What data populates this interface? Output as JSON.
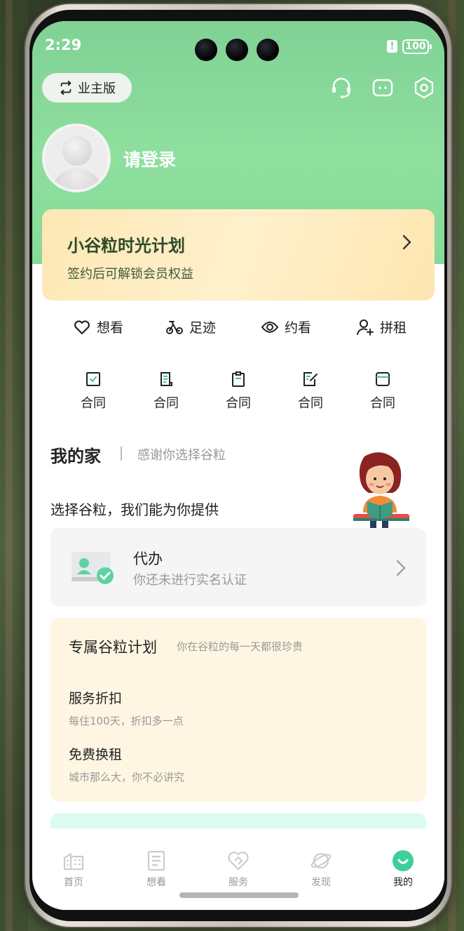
{
  "status_bar": {
    "time": "2:29",
    "battery_level": "100",
    "battery_alert": "!"
  },
  "header": {
    "owner_button_label": "业主版",
    "login_prompt": "请登录",
    "icons": [
      "headset-icon",
      "chat-icon",
      "settings-icon"
    ]
  },
  "plan_card": {
    "title": "小谷粒时光计划",
    "subtitle": "签约后可解锁会员权益"
  },
  "quick_links": [
    {
      "label": "想看",
      "icon": "heart-icon"
    },
    {
      "label": "足迹",
      "icon": "bike-icon"
    },
    {
      "label": "约看",
      "icon": "eye-icon"
    },
    {
      "label": "拼租",
      "icon": "add-user-icon"
    }
  ],
  "contracts": [
    {
      "label": "合同",
      "icon": "check-doc-icon"
    },
    {
      "label": "合同",
      "icon": "doc-list-icon"
    },
    {
      "label": "合同",
      "icon": "clipboard-icon"
    },
    {
      "label": "合同",
      "icon": "edit-doc-icon"
    },
    {
      "label": "合同",
      "icon": "folder-doc-icon"
    }
  ],
  "my_home": {
    "title": "我的家",
    "subtitle": "感谢你选择谷粒",
    "choose_text": "选择谷粒，我们能为你提供"
  },
  "daiban": {
    "title": "代办",
    "subtitle": "你还未进行实名认证"
  },
  "exclusive": {
    "title": "专属谷粒计划",
    "subtitle": "你在谷粒的每一天都很珍贵",
    "items": [
      {
        "title": "服务折扣",
        "desc": "每住100天，折扣多一点"
      },
      {
        "title": "免费换租",
        "desc": "城市那么大，你不必讲究"
      }
    ]
  },
  "tab_bar": [
    {
      "label": "首页",
      "icon": "building-icon",
      "active": false
    },
    {
      "label": "想看",
      "icon": "list-doc-icon",
      "active": false
    },
    {
      "label": "服务",
      "icon": "service-heart-icon",
      "active": false
    },
    {
      "label": "发现",
      "icon": "planet-icon",
      "active": false
    },
    {
      "label": "我的",
      "icon": "smile-icon",
      "active": true
    }
  ],
  "colors": {
    "header_green": "#86da98",
    "accent_green": "#4ccf98",
    "plan_card_bg": "#fde7b4",
    "exclusive_bg": "#fef6e2"
  }
}
